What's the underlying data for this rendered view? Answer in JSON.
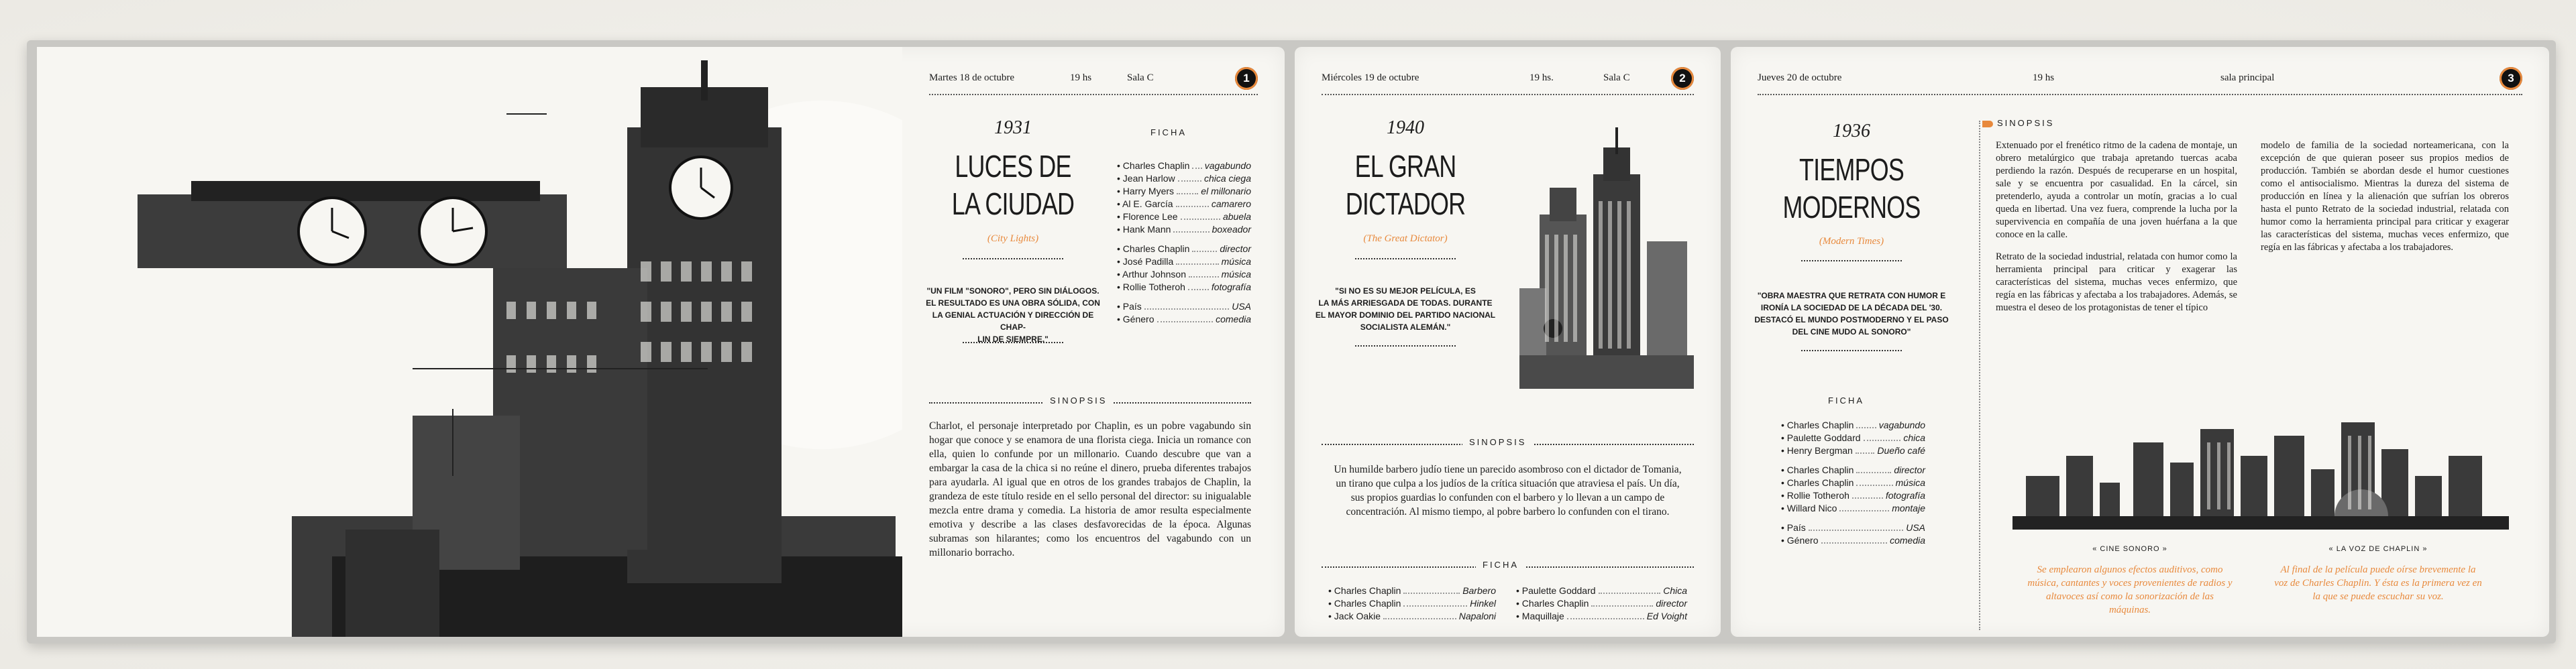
{
  "panels": [
    {
      "date": "Martes 18 de octubre",
      "time": "19 hs",
      "room": "Sala C",
      "number": "1",
      "year": "1931",
      "title_line1": "LUCES DE",
      "title_line2": "LA CIUDAD",
      "original_title": "(City Lights)",
      "quote_lines": [
        "\"UN FILM \"SONORO\", PERO SIN DIÁLOGOS.",
        "EL RESULTADO ES UNA OBRA SÓLIDA, CON",
        "LA GENIAL ACTUACIÓN Y DIRECCIÓN DE CHAP-",
        "LIN DE SIEMPRE.\""
      ],
      "ficha_label": "FICHA",
      "cast": [
        {
          "name": "Charles Chaplin",
          "role": "vagabundo"
        },
        {
          "name": "Jean Harlow",
          "role": "chica ciega"
        },
        {
          "name": "Harry Myers",
          "role": "el millonario"
        },
        {
          "name": "Al E. García",
          "role": "camarero"
        },
        {
          "name": "Florence Lee",
          "role": "abuela"
        },
        {
          "name": "Hank Mann",
          "role": "boxeador"
        }
      ],
      "crew": [
        {
          "name": "Charles Chaplin",
          "role": "director"
        },
        {
          "name": "José Padilla",
          "role": "música"
        },
        {
          "name": "Arthur Johnson",
          "role": "música"
        },
        {
          "name": "Rollie Totheroh",
          "role": "fotografía"
        }
      ],
      "info": [
        {
          "name": "País",
          "role": "USA"
        },
        {
          "name": "Género",
          "role": "comedia"
        }
      ],
      "sinopsis_label": "SINOPSIS",
      "sinopsis": "Charlot, el personaje interpretado por Chaplin, es un pobre vagabundo sin hogar que conoce y se enamora de una florista ciega. Inicia un romance con ella, quien lo confunde por un millonario. Cuando descubre que van a embargar la casa de la chica si no reúne el dinero, prueba diferentes trabajos para ayudarla. Al igual que en otros de los grandes trabajos de Chaplin, la grandeza de este título reside en el sello personal del director: su inigualable mezcla entre drama y comedia. La historia de amor resulta especialmente emotiva y describe a las clases desfavorecidas de la época. Algunas subramas son hilarantes; como los encuentros del vagabundo con un millonario borracho."
    },
    {
      "date": "Miércoles 19 de octubre",
      "time": "19 hs.",
      "room": "Sala C",
      "number": "2",
      "year": "1940",
      "title_line1": "EL GRAN",
      "title_line2": "DICTADOR",
      "original_title": "(The Great Dictator)",
      "quote_lines": [
        "\"SI NO ES SU MEJOR PELÍCULA, ES",
        "LA MÁS ARRIESGADA DE TODAS. DURANTE",
        "EL MAYOR DOMINIO DEL PARTIDO NACIONAL",
        "SOCIALISTA ALEMÁN.\""
      ],
      "sinopsis_label": "SINOPSIS",
      "sinopsis": "Un humilde barbero judío tiene un parecido asombroso con el dictador de Tomania, un tirano que culpa a los judíos de la crítica situación que atraviesa el país. Un día, sus propios guardias lo confunden con el barbero y lo llevan a un campo de concentración. Al mismo tiempo, al pobre barbero lo confunden con el tirano.",
      "ficha_label": "FICHA",
      "cast_left": [
        {
          "name": "Charles Chaplin",
          "role": "Barbero"
        },
        {
          "name": "Charles Chaplin",
          "role": "Hinkel"
        },
        {
          "name": "Jack Oakie",
          "role": "Napaloni"
        }
      ],
      "cast_right": [
        {
          "name": "Paulette Goddard",
          "role": "Chica"
        },
        {
          "name": "Charles Chaplin",
          "role": "director"
        },
        {
          "name": "Maquillaje",
          "role": "Ed Voight"
        }
      ]
    },
    {
      "date": "Jueves 20 de octubre",
      "time": "19 hs",
      "room": "sala principal",
      "number": "3",
      "year": "1936",
      "title_line1": "TIEMPOS",
      "title_line2": "MODERNOS",
      "original_title": "(Modern Times)",
      "quote_lines": [
        "\"OBRA MAESTRA QUE RETRATA CON HUMOR E",
        "IRONÍA LA SOCIEDAD DE LA DÉCADA DEL '30.",
        "DESTACÓ EL MUNDO POSTMODERNO Y EL PASO",
        "DEL CINE MUDO AL SONORO\""
      ],
      "ficha_label": "FICHA",
      "cast": [
        {
          "name": "Charles Chaplin",
          "role": "vagabundo"
        },
        {
          "name": "Paulette Goddard",
          "role": "chica"
        },
        {
          "name": "Henry Bergman",
          "role": "Dueño café"
        }
      ],
      "crew": [
        {
          "name": "Charles Chaplin",
          "role": "director"
        },
        {
          "name": "Charles Chaplin",
          "role": "música"
        },
        {
          "name": "Rollie Totheroh",
          "role": "fotografía"
        },
        {
          "name": "Willard Nico",
          "role": "montaje"
        }
      ],
      "info": [
        {
          "name": "País",
          "role": "USA"
        },
        {
          "name": "Género",
          "role": "comedia"
        }
      ],
      "sinopsis_label": "SINOPSIS",
      "sinopsis_col1_p1": "Extenuado por el frenético ritmo de la cadena de montaje, un obrero metalúrgico que trabaja apretando tuercas acaba perdiendo la razón. Después de recuperarse en un hospital, sale y se encuentra por casualidad. En la cárcel, sin pretenderlo, ayuda a controlar un motín, gracias a lo cual queda en libertad. Una vez fuera, comprende la lucha por la supervivencia en compañía de una joven huérfana a la que conoce en la calle.",
      "sinopsis_col1_p2": "Retrato de la sociedad industrial, relatada con humor como la herramienta principal para criticar y exagerar las características del sistema, muchas veces enfermizo, que regía en las fábricas y afectaba a los trabajadores. Además, se muestra el deseo de los protagonistas de tener el típico",
      "sinopsis_col2": "modelo de familia de la sociedad norteamericana, con la excepción de que quieran poseer sus propios medios de producción. También se abordan desde el humor cuestiones como el antisocialismo. Mientras la dureza del sistema de producción en línea y la alienación que sufrían los obreros hasta el punto Retrato de la sociedad industrial, relatada con humor como la herramienta principal para criticar y exagerar las características del sistema, muchas veces enfermizo, que regía en las fábricas y afectaba a los trabajadores.",
      "caption_left": "« CINE SONORO »",
      "caption_right": "« LA VOZ DE CHAPLIN »",
      "italic_left": "Se emplearon algunos efectos auditivos, como música, cantantes y voces provenientes de radios y altavoces así como la sonorización de las máquinas.",
      "italic_right": "Al final de la película puede oírse brevemente la voz de Charles Chaplin. Y ésta es la primera vez en la que se puede escuchar su voz."
    }
  ],
  "colors": {
    "accent": "#e8893c",
    "paper": "#f7f6f2",
    "ink": "#1c1c1c"
  }
}
